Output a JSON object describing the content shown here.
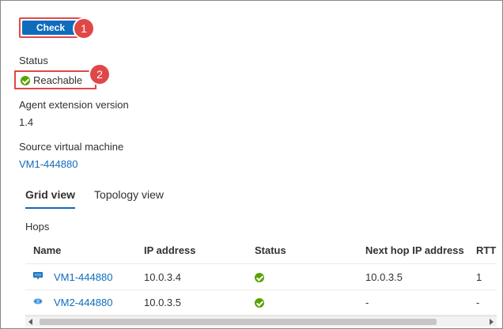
{
  "actions": {
    "check_label": "Check"
  },
  "callouts": [
    "1",
    "2"
  ],
  "status": {
    "label": "Status",
    "value": "Reachable",
    "color": "#57a300"
  },
  "agent": {
    "label": "Agent extension version",
    "value": "1.4"
  },
  "source_vm": {
    "label": "Source virtual machine",
    "value": "VM1-444880"
  },
  "tabs": [
    {
      "label": "Grid view",
      "active": true
    },
    {
      "label": "Topology view",
      "active": false
    }
  ],
  "hops": {
    "title": "Hops",
    "columns": [
      "Name",
      "IP address",
      "Status",
      "Next hop IP address",
      "RTT"
    ],
    "rows": [
      {
        "icon": "vm-monitor-icon",
        "name": "VM1-444880",
        "ip": "10.0.3.4",
        "status": "ok",
        "next_hop": "10.0.3.5",
        "rtt": "1"
      },
      {
        "icon": "network-interface-icon",
        "name": "VM2-444880",
        "ip": "10.0.3.5",
        "status": "ok",
        "next_hop": "-",
        "rtt": "-"
      }
    ]
  },
  "colors": {
    "accent": "#0f6cbd",
    "highlight": "#e04848",
    "success": "#57a300"
  }
}
